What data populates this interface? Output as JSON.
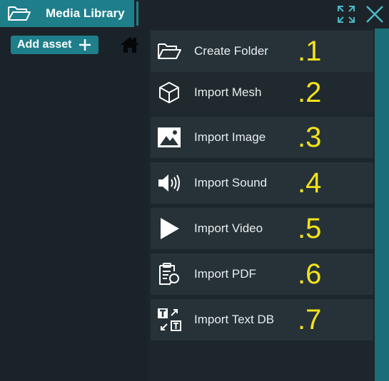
{
  "window": {
    "title": "Media Library",
    "accent_color": "#1e7f8b",
    "number_color": "#f4e21c"
  },
  "toolbar": {
    "add_asset_label": "Add asset"
  },
  "menu": {
    "items": [
      {
        "label": "Create Folder",
        "number": ".1",
        "icon": "folder-open-icon"
      },
      {
        "label": "Import Mesh",
        "number": ".2",
        "icon": "cube-icon"
      },
      {
        "label": "Import Image",
        "number": ".3",
        "icon": "image-icon"
      },
      {
        "label": "Import Sound",
        "number": ".4",
        "icon": "speaker-icon"
      },
      {
        "label": "Import Video",
        "number": ".5",
        "icon": "play-icon"
      },
      {
        "label": "Import PDF",
        "number": ".6",
        "icon": "pdf-document-icon"
      },
      {
        "label": "Import Text DB",
        "number": ".7",
        "icon": "text-db-icon"
      }
    ]
  }
}
